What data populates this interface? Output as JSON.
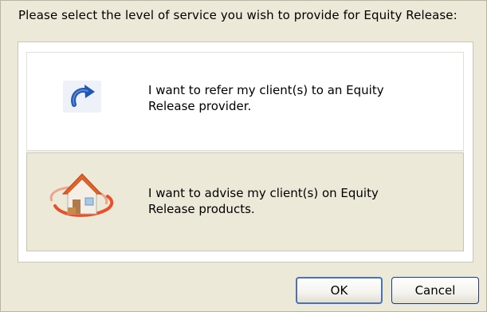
{
  "dialog": {
    "prompt": "Please select the level of service you wish to provide for Equity Release:"
  },
  "options": [
    {
      "label": "I want to refer my client(s) to an Equity Release provider.",
      "icon": "refer-arrow-icon",
      "selected": false
    },
    {
      "label": "I want to advise my client(s) on Equity Release products.",
      "icon": "house-icon",
      "selected": true
    }
  ],
  "buttons": {
    "ok_label": "OK",
    "cancel_label": "Cancel"
  },
  "colors": {
    "dialog_background": "#ece9d8",
    "panel_background": "#ffffff",
    "selected_option_background": "#ece9d8",
    "refer_icon_blue": "#1f55b4",
    "house_roof": "#e0632a",
    "swoosh": "#e8502c"
  }
}
